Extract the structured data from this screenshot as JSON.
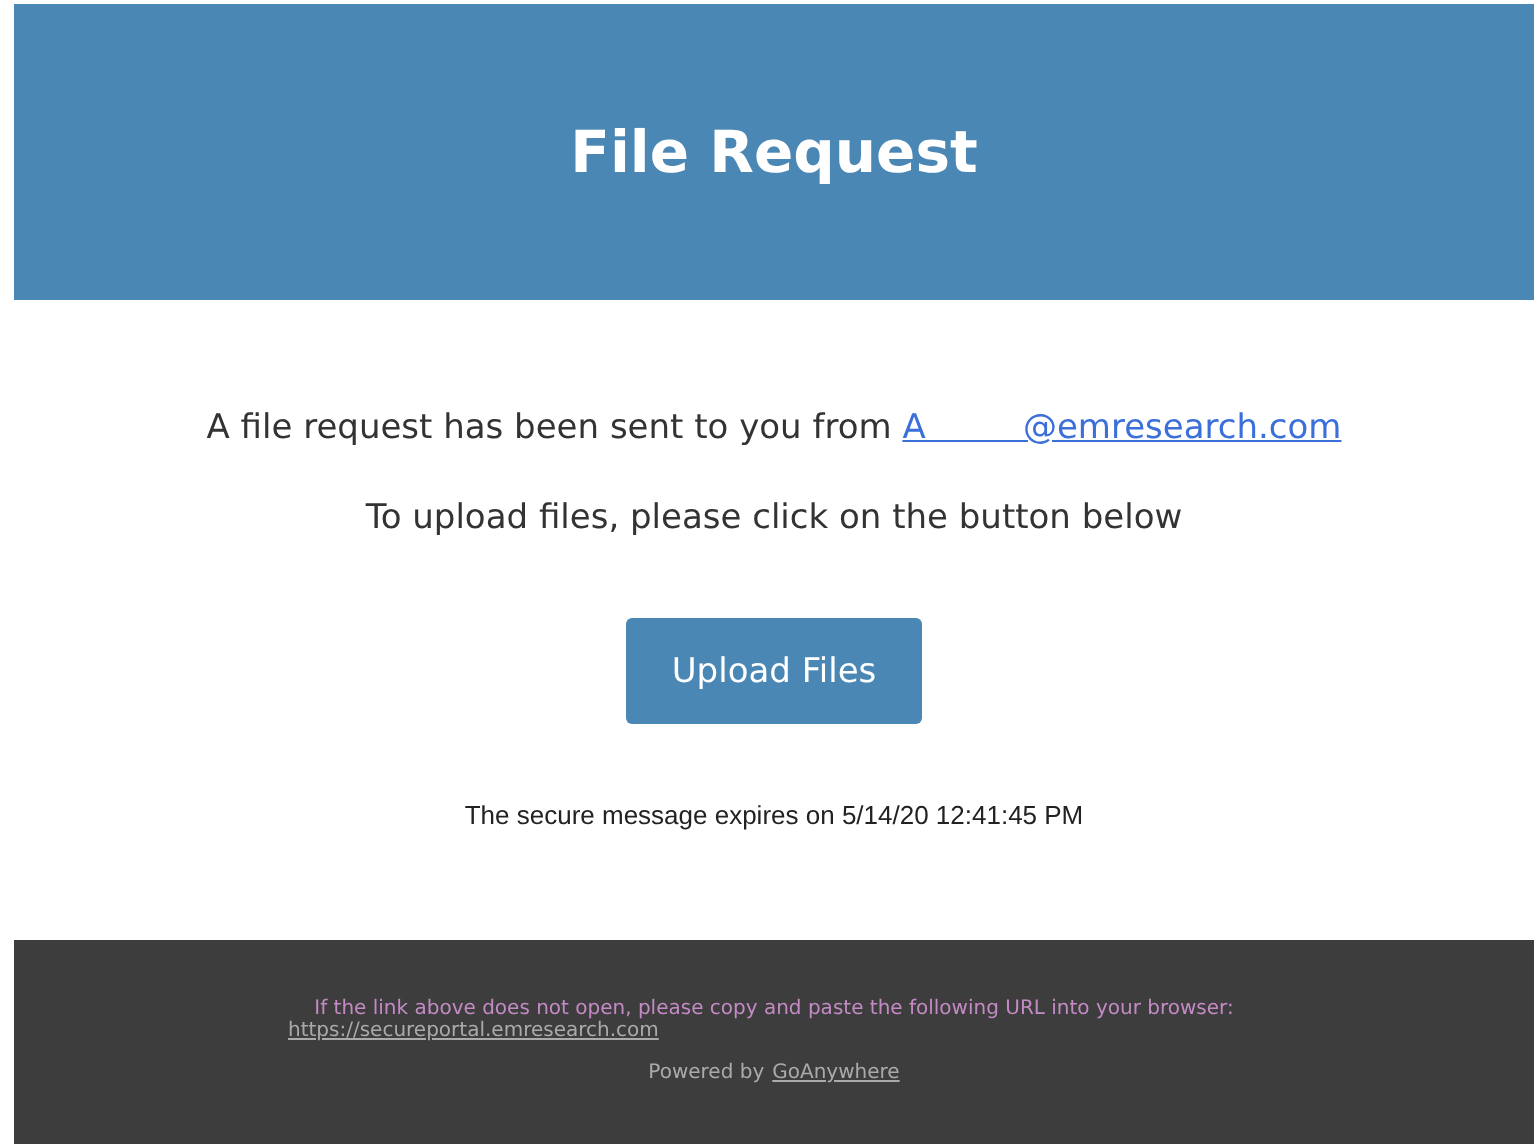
{
  "header": {
    "title": "File Request"
  },
  "message": {
    "text": "A file request has been sent to you from ",
    "sender": "A         @emresearch.com"
  },
  "instruction": "To upload files, please click on the button below",
  "button": "Upload Files",
  "expiry": "The secure message expires on 5/14/20 12:41:45 PM",
  "footer": {
    "notice": "If the link above does not open, please copy and paste the following URL into your browser:",
    "url": "https://secureportal.emresearch.com",
    "powered_text": "Powered by",
    "powered_link": "GoAnywhere"
  }
}
